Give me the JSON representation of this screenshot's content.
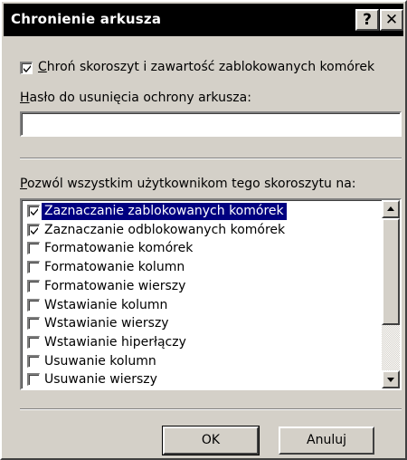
{
  "window": {
    "title": "Chronienie arkusza",
    "help_label": "?",
    "close_label": "✕"
  },
  "protect_checkbox": {
    "checked": true,
    "label_access": "C",
    "label_rest": "hroń skoroszyt i zawartość zablokowanych komórek"
  },
  "password": {
    "label_access": "H",
    "label_rest": "asło do usunięcia ochrony arkusza:",
    "value": ""
  },
  "permissions": {
    "label_access": "P",
    "label_rest": "ozwól wszystkim użytkownikom tego skoroszytu na:",
    "items": [
      {
        "label": "Zaznaczanie zablokowanych komórek",
        "checked": true,
        "selected": true
      },
      {
        "label": "Zaznaczanie odblokowanych komórek",
        "checked": true,
        "selected": false
      },
      {
        "label": "Formatowanie komórek",
        "checked": false,
        "selected": false
      },
      {
        "label": "Formatowanie kolumn",
        "checked": false,
        "selected": false
      },
      {
        "label": "Formatowanie wierszy",
        "checked": false,
        "selected": false
      },
      {
        "label": "Wstawianie kolumn",
        "checked": false,
        "selected": false
      },
      {
        "label": "Wstawianie wierszy",
        "checked": false,
        "selected": false
      },
      {
        "label": "Wstawianie hiperłączy",
        "checked": false,
        "selected": false
      },
      {
        "label": "Usuwanie kolumn",
        "checked": false,
        "selected": false
      },
      {
        "label": "Usuwanie wierszy",
        "checked": false,
        "selected": false
      }
    ]
  },
  "buttons": {
    "ok": "OK",
    "cancel": "Anuluj"
  },
  "colors": {
    "face": "#d4d0c8",
    "titlebar": "#000000",
    "selection": "#000080"
  }
}
